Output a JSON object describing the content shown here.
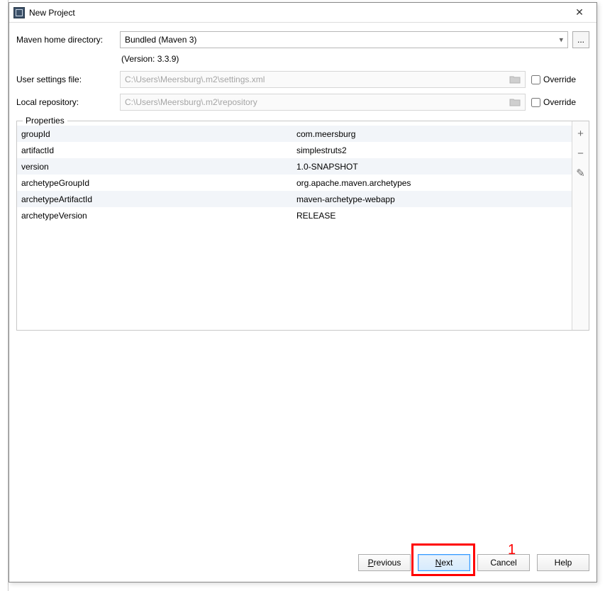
{
  "title": "New Project",
  "labels": {
    "mavenHome": "Maven home directory:",
    "userSettings": "User settings file:",
    "localRepo": "Local repository:",
    "override": "Override",
    "properties": "Properties"
  },
  "mavenHome": {
    "selected": "Bundled (Maven 3)",
    "version": "(Version: 3.3.9)"
  },
  "userSettingsPath": "C:\\Users\\Meersburg\\.m2\\settings.xml",
  "localRepoPath": "C:\\Users\\Meersburg\\.m2\\repository",
  "properties": [
    {
      "key": "groupId",
      "value": "com.meersburg"
    },
    {
      "key": "artifactId",
      "value": "simplestruts2"
    },
    {
      "key": "version",
      "value": "1.0-SNAPSHOT"
    },
    {
      "key": "archetypeGroupId",
      "value": "org.apache.maven.archetypes"
    },
    {
      "key": "archetypeArtifactId",
      "value": "maven-archetype-webapp"
    },
    {
      "key": "archetypeVersion",
      "value": "RELEASE"
    }
  ],
  "buttons": {
    "previous": {
      "pre": "",
      "u": "P",
      "post": "revious"
    },
    "next": {
      "pre": "",
      "u": "N",
      "post": "ext"
    },
    "cancel": "Cancel",
    "help": "Help",
    "browse": "..."
  },
  "icons": {
    "close": "✕",
    "plus": "+",
    "minus": "−",
    "edit": "✎",
    "chevronDown": "▾"
  },
  "annotation": {
    "number": "1"
  }
}
